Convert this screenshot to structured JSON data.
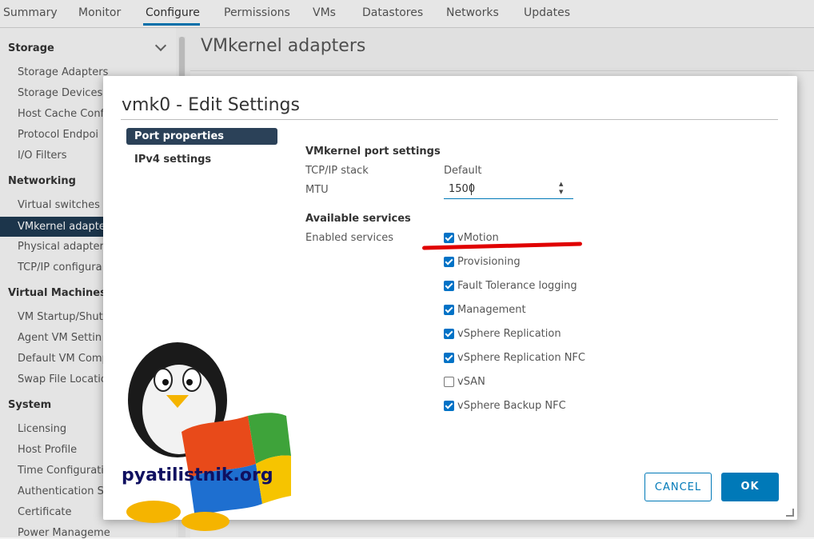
{
  "tabs": [
    "Summary",
    "Monitor",
    "Configure",
    "Permissions",
    "VMs",
    "Datastores",
    "Networks",
    "Updates"
  ],
  "sidebar": {
    "sections": [
      {
        "title": "Storage",
        "items": [
          "Storage Adapters",
          "Storage Devices",
          "Host Cache Conf",
          "Protocol Endpoi",
          "I/O Filters"
        ]
      },
      {
        "title": "Networking",
        "items": [
          "Virtual switches",
          "VMkernel adapte",
          "Physical adapter",
          "TCP/IP configura"
        ]
      },
      {
        "title": "Virtual Machines",
        "items": [
          "VM Startup/Shut",
          "Agent VM Settin",
          "Default VM Comp",
          "Swap File Locatio"
        ]
      },
      {
        "title": "System",
        "items": [
          "Licensing",
          "Host Profile",
          "Time Configuratio",
          "Authentication Se",
          "Certificate",
          "Power Manageme"
        ]
      }
    ]
  },
  "main": {
    "title": "VMkernel adapters"
  },
  "dialog": {
    "title": "vmk0 - Edit Settings",
    "nav": [
      "Port properties",
      "IPv4 settings"
    ],
    "port_settings_header": "VMkernel port settings",
    "tcpip_label": "TCP/IP stack",
    "tcpip_value": "Default",
    "mtu_label": "MTU",
    "mtu_value": "1500",
    "services_header": "Available services",
    "enabled_services_label": "Enabled services",
    "services": [
      {
        "label": "vMotion",
        "checked": true
      },
      {
        "label": "Provisioning",
        "checked": true
      },
      {
        "label": "Fault Tolerance logging",
        "checked": true
      },
      {
        "label": "Management",
        "checked": true
      },
      {
        "label": "vSphere Replication",
        "checked": true
      },
      {
        "label": "vSphere Replication NFC",
        "checked": true
      },
      {
        "label": "vSAN",
        "checked": false
      },
      {
        "label": "vSphere Backup NFC",
        "checked": true
      }
    ],
    "cancel_label": "CANCEL",
    "ok_label": "OK"
  },
  "watermark": {
    "text": "pyatilistnik.org"
  },
  "colors": {
    "accent": "#0079b8",
    "selected": "#1f3a52",
    "annotation": "#e00000"
  }
}
